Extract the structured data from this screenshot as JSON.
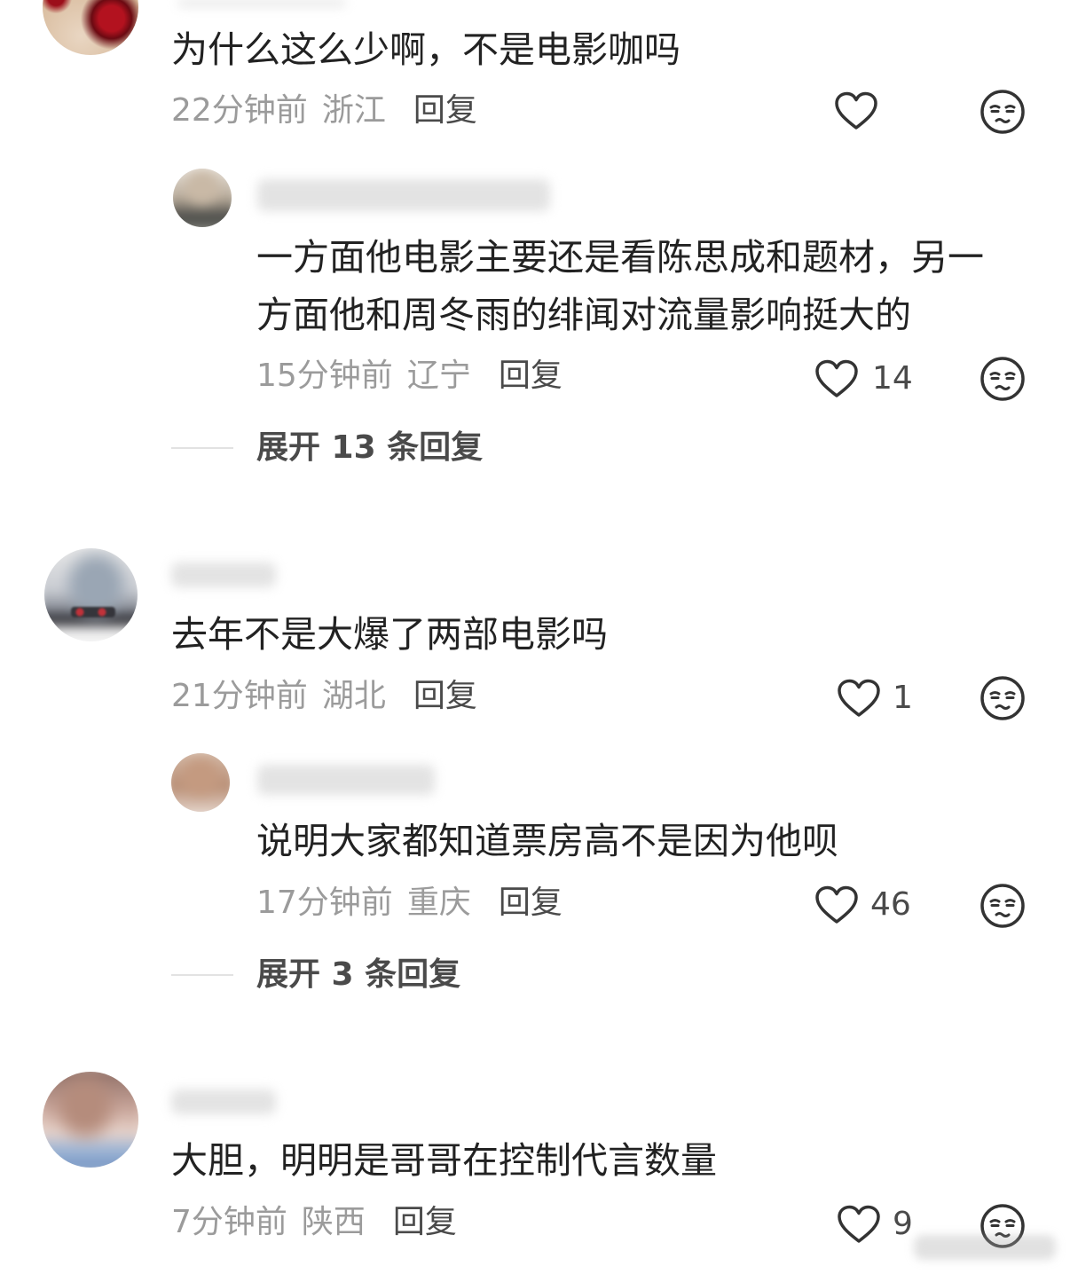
{
  "colors": {
    "background": "#ffffff",
    "text": "#222222",
    "meta": "#9b9b9b",
    "action": "#4a4a4a",
    "icon": "#333333"
  },
  "icons": {
    "like": "heart-outline-icon",
    "dislike": "dislike-face-icon"
  },
  "comments": [
    {
      "text": "为什么这么少啊，不是电影咖吗",
      "time": "22分钟前",
      "location": "浙江",
      "reply_label": "回复",
      "replies": [
        {
          "text": "一方面他电影主要还是看陈思成和题材，另一方面他和周冬雨的绯闻对流量影响挺大的",
          "time": "15分钟前",
          "location": "辽宁",
          "reply_label": "回复",
          "likes": 14
        }
      ],
      "expand_label": "展开 13 条回复"
    },
    {
      "text": "去年不是大爆了两部电影吗",
      "time": "21分钟前",
      "location": "湖北",
      "reply_label": "回复",
      "likes": 1,
      "replies": [
        {
          "text": "说明大家都知道票房高不是因为他呗",
          "time": "17分钟前",
          "location": "重庆",
          "reply_label": "回复",
          "likes": 46
        }
      ],
      "expand_label": "展开 3 条回复"
    },
    {
      "text": "大胆，明明是哥哥在控制代言数量",
      "time": "7分钟前",
      "location": "陕西",
      "reply_label": "回复",
      "likes": 9
    }
  ]
}
